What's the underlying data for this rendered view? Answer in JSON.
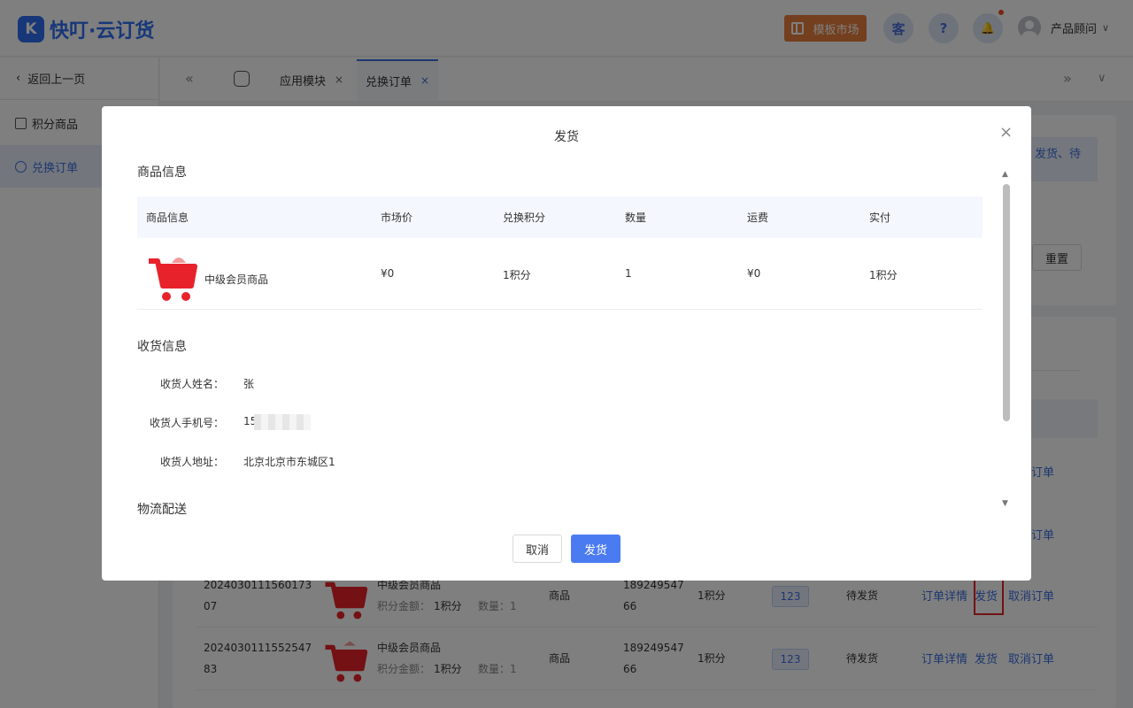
{
  "app": {
    "logo_mark": "K",
    "logo_text": "快叮·云订货"
  },
  "header": {
    "market_button": "模板市场",
    "support_icon": "客",
    "help_icon": "?",
    "bell_icon": "🔔",
    "user_name": "产品顾问",
    "caret": "∨"
  },
  "sidebar": {
    "back": "返回上一页",
    "items": [
      {
        "label": "积分商品"
      },
      {
        "label": "兑换订单"
      }
    ]
  },
  "tabs": {
    "left_arrow": "«",
    "right_arrow": "»",
    "dropdown": "∨",
    "items": [
      {
        "label": "应用模块",
        "close": "×"
      },
      {
        "label": "兑换订单",
        "close": "×"
      }
    ]
  },
  "background": {
    "notice_text": "发货、待",
    "reset_button": "重置",
    "cancel_order_partial": "订单",
    "rows": [
      {
        "order_no_1": "2024030111560173",
        "order_no_2": "07",
        "product": "中级会员商品",
        "points_label": "积分金额：",
        "points": "1积分",
        "qty_label": "数量：",
        "qty": "1",
        "type": "商品",
        "phone_1": "189249547",
        "phone_2": "66",
        "paid": "1积分",
        "tag": "123",
        "status": "待发货",
        "detail_link": "订单详情",
        "ship_link": "发货",
        "cancel_link": "取消订单"
      },
      {
        "order_no_1": "2024030111552547",
        "order_no_2": "83",
        "product": "中级会员商品",
        "points_label": "积分金额：",
        "points": "1积分",
        "qty_label": "数量：",
        "qty": "1",
        "type": "商品",
        "phone_1": "189249547",
        "phone_2": "66",
        "paid": "1积分",
        "tag": "123",
        "status": "待发货",
        "detail_link": "订单详情",
        "ship_link": "发货",
        "cancel_link": "取消订单"
      }
    ]
  },
  "modal": {
    "title": "发货",
    "close": "×",
    "goods_section": "商品信息",
    "columns": [
      "商品信息",
      "市场价",
      "兑换积分",
      "数量",
      "运费",
      "实付"
    ],
    "goods": {
      "name": "中级会员商品",
      "market_price": "¥0",
      "points": "1积分",
      "qty": "1",
      "freight": "¥0",
      "paid": "1积分"
    },
    "receiver_section": "收货信息",
    "receiver": {
      "name_label": "收货人姓名：",
      "name": "张",
      "phone_label": "收货人手机号：",
      "phone": "15",
      "address_label": "收货人地址：",
      "address": "北京北京市东城区1"
    },
    "logistics_section": "物流配送",
    "scroll_up": "▲",
    "scroll_down": "▼",
    "cancel_button": "取消",
    "ship_button": "发货"
  },
  "colors": {
    "primary": "#3b6fe0",
    "ship_button": "#4a7bf0",
    "market_button": "#e87e3c",
    "highlight_box": "#e8222b",
    "cart": "#e8222b"
  }
}
